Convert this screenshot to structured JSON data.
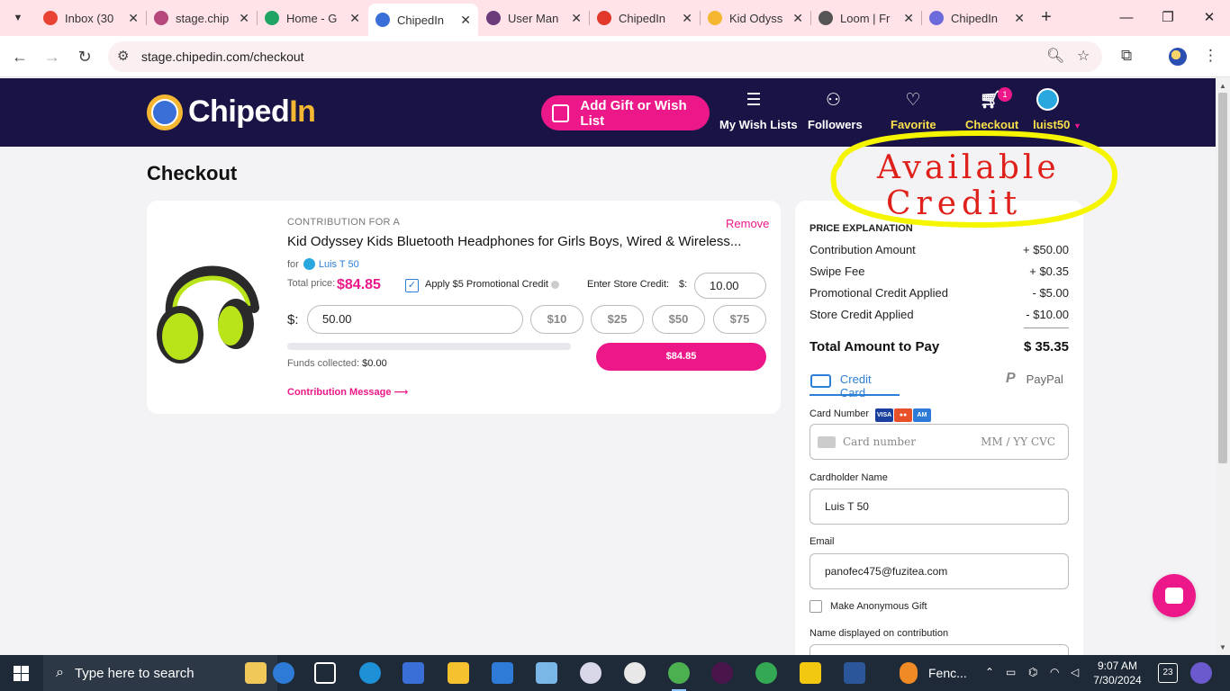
{
  "browser": {
    "tabs": [
      {
        "title": "Inbox (30",
        "color": "#ea4335"
      },
      {
        "title": "stage.chip",
        "color": "#b5477a"
      },
      {
        "title": "Home - G",
        "color": "#1fa463"
      },
      {
        "title": "ChipedIn",
        "color": "#3b6fd8",
        "active": true
      },
      {
        "title": "User Man",
        "color": "#6b3b7a"
      },
      {
        "title": "ChipedIn",
        "color": "#e2382b"
      },
      {
        "title": "Kid Odyss",
        "color": "#f5b731"
      },
      {
        "title": "Loom | Fr",
        "color": "#555555"
      },
      {
        "title": "ChipedIn",
        "color": "#6b6bdc"
      }
    ],
    "url": "stage.chipedin.com/checkout"
  },
  "header": {
    "logo_main": "Chiped",
    "logo_accent": "In",
    "gift_button": "Add Gift or Wish List",
    "nav": {
      "wishlists": "My Wish Lists",
      "followers": "Followers",
      "favorite": "Favorite",
      "checkout": "Checkout",
      "user": "luist50"
    },
    "cart_count": "1"
  },
  "page": {
    "title": "Checkout"
  },
  "item": {
    "contribution_for": "CONTRIBUTION FOR A",
    "remove": "Remove",
    "title": "Kid Odyssey Kids Bluetooth Headphones for Girls Boys, Wired & Wireless...",
    "for_label": "for",
    "recipient": "Luis T 50",
    "total_label": "Total price:",
    "total_value": "$84.85",
    "promo_label": "Apply $5 Promotional Credit",
    "promo_checked": true,
    "store_label": "Enter Store Credit:",
    "store_currency": "$:",
    "store_value": "10.00",
    "amount_currency": "$:",
    "amount_value": "50.00",
    "chips": [
      "$10",
      "$25",
      "$50",
      "$75"
    ],
    "funds_progress": 0,
    "funds_label": "Funds collected:",
    "funds_value": "$0.00",
    "pay_button": "$84.85",
    "message_link": "Contribution Message"
  },
  "price": {
    "title": "PRICE EXPLANATION",
    "rows": [
      {
        "label": "Contribution Amount",
        "value": "+ $50.00"
      },
      {
        "label": "Swipe Fee",
        "value": "+ $0.35"
      },
      {
        "label": "Promotional Credit Applied",
        "value": "- $5.00"
      },
      {
        "label": "Store Credit Applied",
        "value": "- $10.00"
      }
    ],
    "total_label": "Total Amount to Pay",
    "total_value": "$ 35.35",
    "tab_card": "Credit Card",
    "tab_paypal": "PayPal",
    "card_number_label": "Card Number",
    "card_number_placeholder": "Card number",
    "card_exp_cvc_placeholder": "MM / YY  CVC",
    "cardholder_label": "Cardholder Name",
    "cardholder_value": "Luis T 50",
    "email_label": "Email",
    "email_value": "panofec475@fuzitea.com",
    "anonymous_label": "Make Anonymous Gift",
    "display_name_label": "Name displayed on contribution"
  },
  "annotation": {
    "line1": "Available",
    "line2": "Credit",
    "color": "#f5f500",
    "ink": "#e0201a"
  },
  "taskbar": {
    "search_placeholder": "Type here to search",
    "weather_app": "Fenc...",
    "time": "9:07 AM",
    "date": "7/30/2024",
    "notifications": "23"
  },
  "colors": {
    "brand_pink": "#ec1889",
    "header_navy": "#1a1446",
    "gold": "#f5b731",
    "link_blue": "#2b7fd6"
  }
}
